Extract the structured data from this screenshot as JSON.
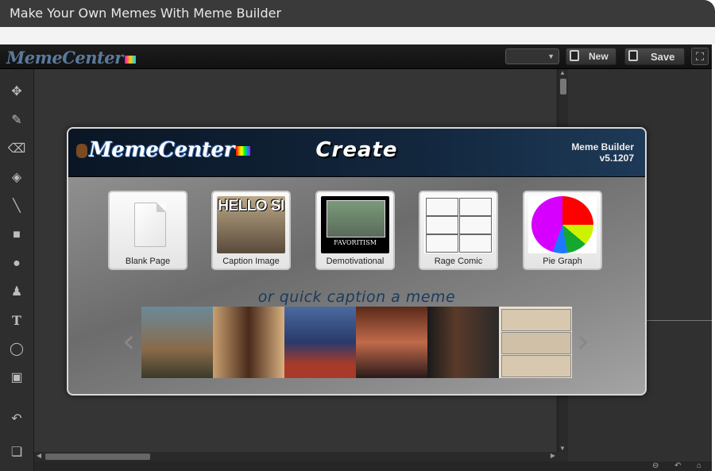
{
  "window": {
    "title": "Make Your Own Memes With Meme Builder"
  },
  "app": {
    "brand": "MemeCenter",
    "toolbar": {
      "new_label": "New",
      "save_label": "Save"
    },
    "tools": [
      "move-tool",
      "brush-tool",
      "eraser-tool",
      "fill-tool",
      "line-tool",
      "rectangle-tool",
      "ellipse-tool",
      "stamp-tool",
      "text-tool",
      "speech-bubble-tool",
      "image-tool",
      "undo-tool",
      "layers-tool"
    ]
  },
  "modal": {
    "logo": "MemeCenter",
    "title": "Create",
    "version_name": "Meme Builder",
    "version_number": "v5.1207",
    "options": [
      {
        "label": "Blank Page"
      },
      {
        "label": "Caption Image",
        "thumb_text": "HELLO SI"
      },
      {
        "label": "Demotivational",
        "thumb_text": "FAVORITISM"
      },
      {
        "label": "Rage Comic"
      },
      {
        "label": "Pie Graph"
      }
    ],
    "quick_caption": "or quick caption a meme",
    "prev_arrow": "‹",
    "next_arrow": "›"
  }
}
